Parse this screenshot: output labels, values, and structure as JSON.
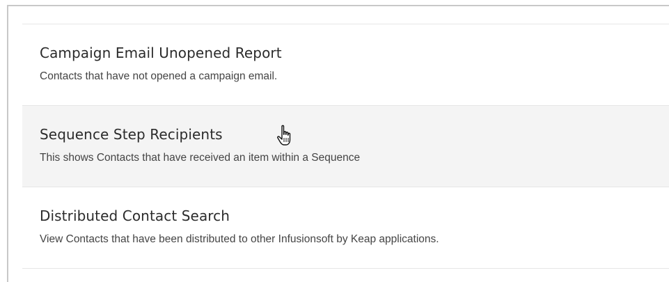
{
  "reports": [
    {
      "title": "Campaign Email Unopened Report",
      "description": "Contacts that have not opened a campaign email.",
      "hovered": false
    },
    {
      "title": "Sequence Step Recipients",
      "description": "This shows Contacts that have received an item within a Sequence",
      "hovered": true
    },
    {
      "title": "Distributed Contact Search",
      "description": "View Contacts that have been distributed to other Infusionsoft by Keap applications.",
      "hovered": false
    }
  ],
  "cursor": {
    "icon": "hand-pointer-icon"
  }
}
